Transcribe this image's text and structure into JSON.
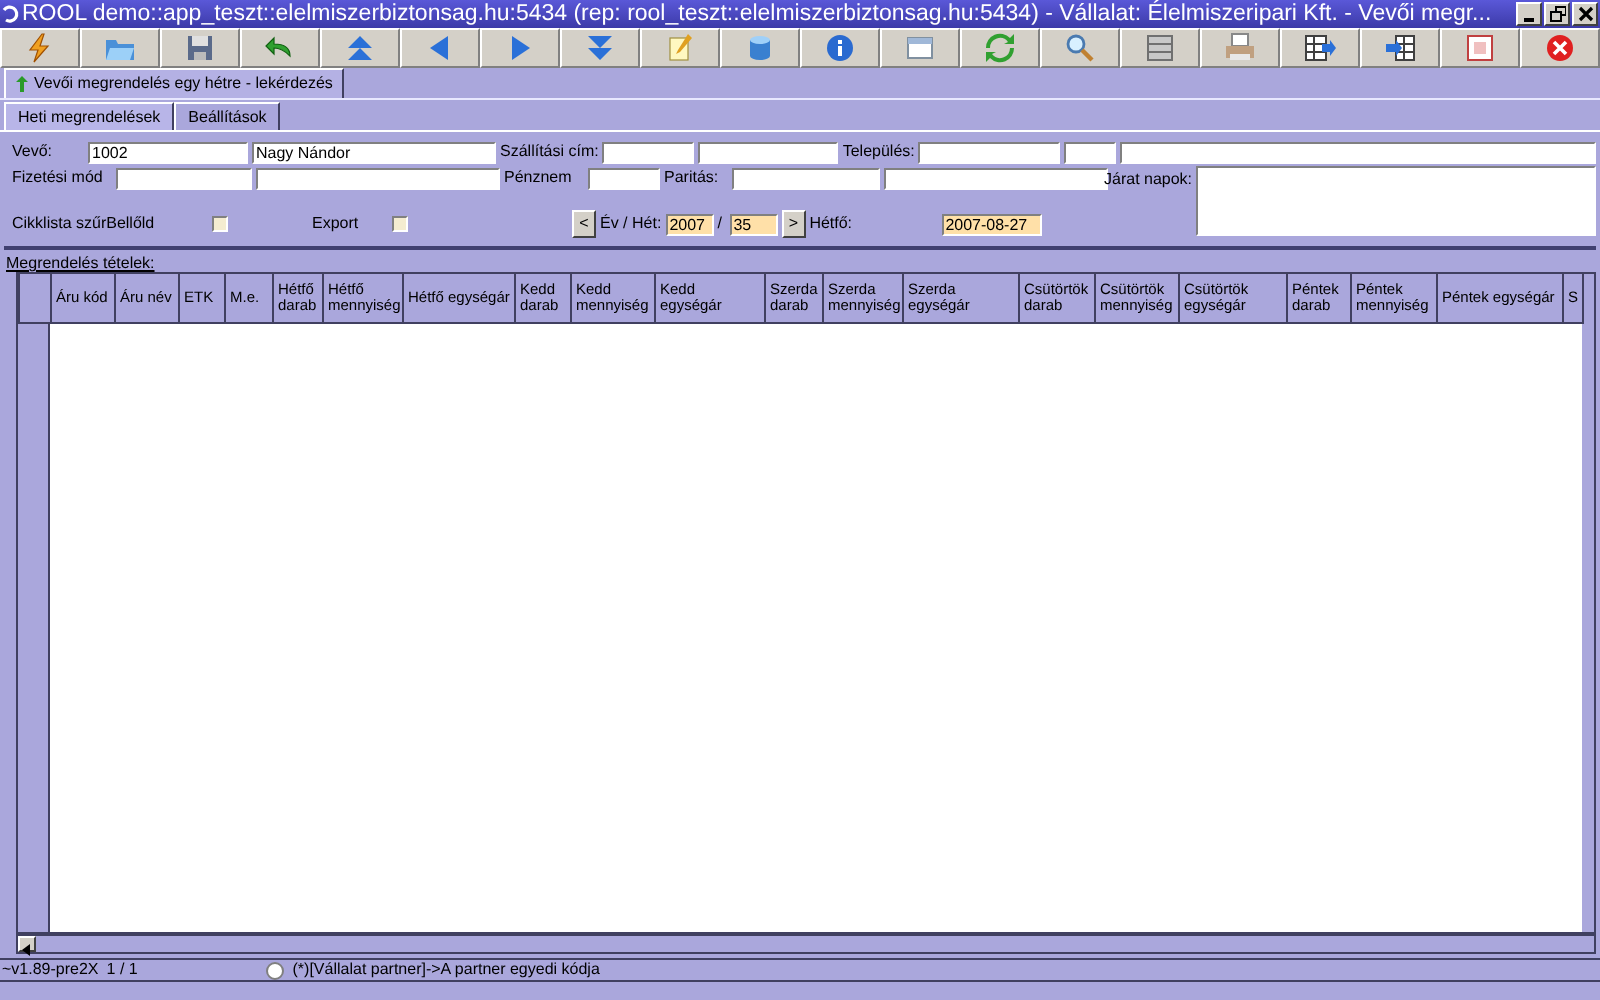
{
  "window": {
    "title": "ROOL demo::app_teszt::elelmiszerbiztonsag.hu:5434 (rep: rool_teszt::elelmiszerbiztonsag.hu:5434) - Vállalat: Élelmiszeripari Kft. - Vevői megr..."
  },
  "toolbar": [
    {
      "kind": "lightning"
    },
    {
      "kind": "folder"
    },
    {
      "kind": "floppy"
    },
    {
      "kind": "undo"
    },
    {
      "kind": "top"
    },
    {
      "kind": "prev"
    },
    {
      "kind": "next"
    },
    {
      "kind": "bottom"
    },
    {
      "kind": "pencil"
    },
    {
      "kind": "cylinder"
    },
    {
      "kind": "info"
    },
    {
      "kind": "window"
    },
    {
      "kind": "refresh"
    },
    {
      "kind": "search"
    },
    {
      "kind": "rows"
    },
    {
      "kind": "printer"
    },
    {
      "kind": "gridout"
    },
    {
      "kind": "gridin"
    },
    {
      "kind": "frame"
    },
    {
      "kind": "close"
    }
  ],
  "doc_tabs": [
    {
      "label": "Vevői megrendelés egy hétre - lekérdezés",
      "selected": true
    }
  ],
  "tabs": [
    {
      "label": "Heti megrendelések",
      "selected": true
    },
    {
      "label": "Beállítások",
      "selected": false
    }
  ],
  "form": {
    "row_1": [
      {
        "kind": "label",
        "text": "Vevő:"
      },
      {
        "kind": "input",
        "value": "1002"
      },
      {
        "kind": "input",
        "value": "Nagy Nándor"
      },
      {
        "kind": "label",
        "text": "Szállítási cím:"
      },
      {
        "kind": "input"
      },
      {
        "kind": "input"
      },
      {
        "kind": "label",
        "text": "Település:"
      },
      {
        "kind": "input"
      },
      {
        "kind": "input"
      },
      {
        "kind": "input"
      }
    ],
    "row_2": [
      {
        "kind": "label",
        "text": "Fizetési mód"
      },
      {
        "kind": "input"
      },
      {
        "kind": "input"
      },
      {
        "kind": "label",
        "text": "Pénznem"
      },
      {
        "kind": "input"
      },
      {
        "kind": "label",
        "text": "Paritás:"
      },
      {
        "kind": "input"
      },
      {
        "kind": "input"
      }
    ],
    "row_3": [
      {
        "kind": "label",
        "text": "Cikklista szűrBellőld"
      },
      {
        "kind": "checkbox",
        "checked": false
      },
      {
        "kind": "label",
        "text": "Export"
      },
      {
        "kind": "checkbox",
        "checked": false
      },
      {
        "kind": "button",
        "text": "<"
      },
      {
        "kind": "label",
        "text": "Év / Hét:"
      },
      {
        "kind": "input",
        "value": "2007",
        "highlight": true
      },
      {
        "kind": "label",
        "text": "/"
      },
      {
        "kind": "input",
        "value": "35",
        "highlight": true
      },
      {
        "kind": "button",
        "text": ">"
      },
      {
        "kind": "label",
        "text": "Hétfő:"
      },
      {
        "kind": "input",
        "value": "2007-08-27",
        "highlight": true
      }
    ],
    "route_days": {
      "label": "Járat napok:"
    }
  },
  "grid": {
    "title": "Megrendelés tételek:",
    "columns": [
      "Áru kód",
      "Áru név",
      "ETK",
      "M.e.",
      "Hétfő darab",
      "Hétfő mennyiség",
      "Hétfő egységár",
      "Kedd darab",
      "Kedd mennyiség",
      "Kedd egységár",
      "Szerda darab",
      "Szerda mennyiség",
      "Szerda egységár",
      "Csütörtök darab",
      "Csütörtök mennyiség",
      "Csütörtök egységár",
      "Péntek darab",
      "Péntek mennyiség",
      "Péntek egységár",
      "S"
    ]
  },
  "status_bar": {
    "version": "~v1.89-pre2X",
    "record": "1 / 1",
    "radio_checked": false,
    "hint": "(*)[Vállalat partner]->A partner egyedi kódja"
  }
}
